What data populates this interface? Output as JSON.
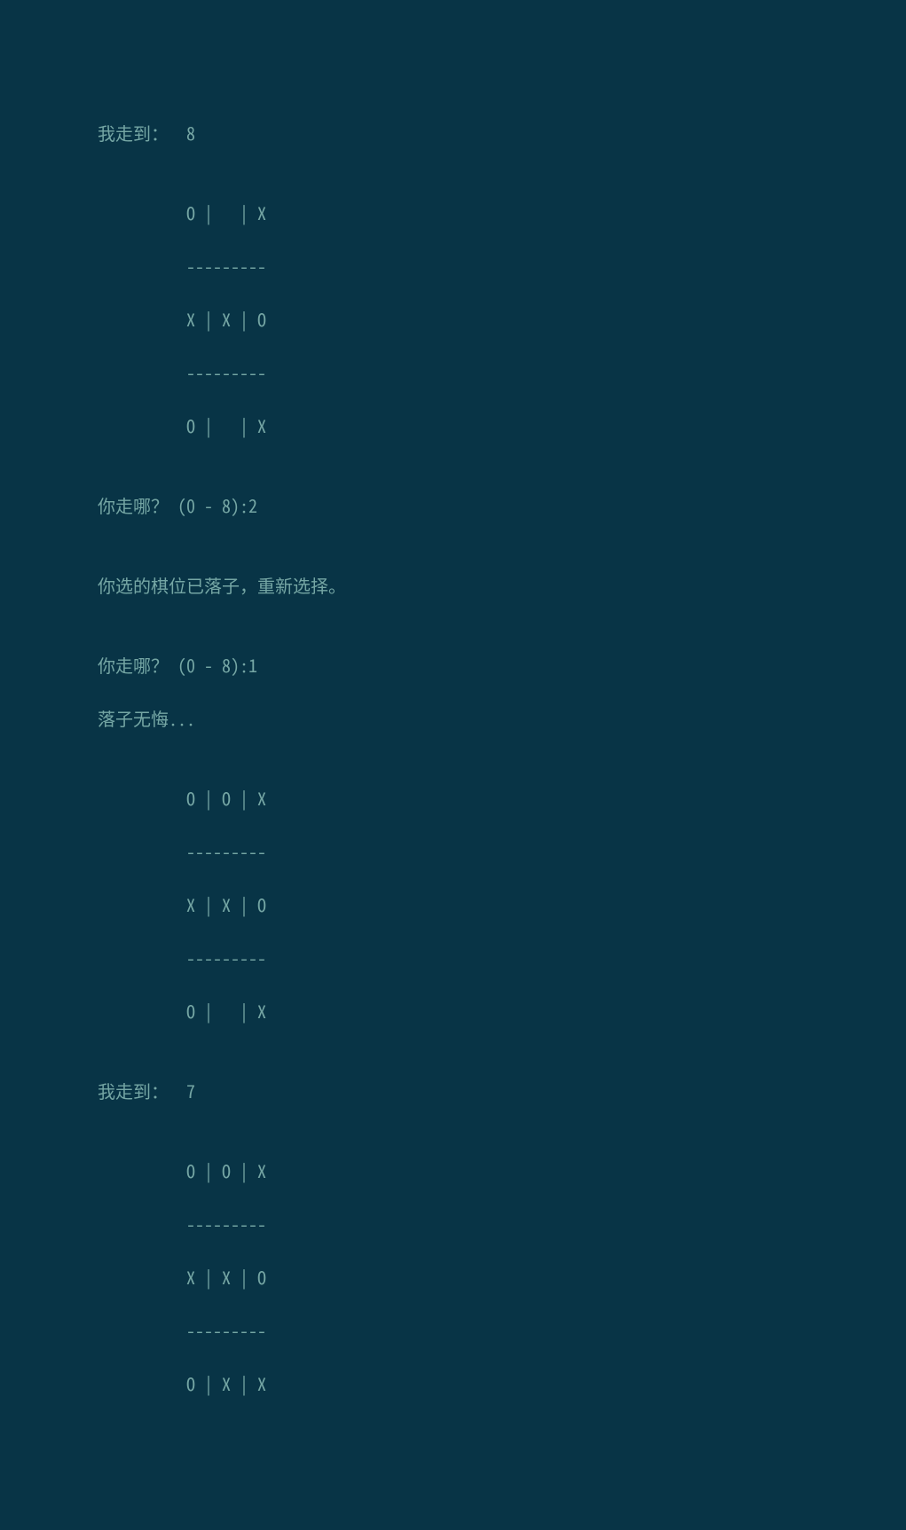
{
  "lines": [
    "我走到：  8",
    "",
    "          O |   | X",
    "          ---------",
    "          X | X | O",
    "          ---------",
    "          O |   | X",
    "",
    "你走哪？ (0 - 8):2",
    "",
    "你选的棋位已落子，重新选择。",
    "",
    "你走哪？ (0 - 8):1",
    "落子无悔...",
    "",
    "          O | O | X",
    "          ---------",
    "          X | X | O",
    "          ---------",
    "          O |   | X",
    "",
    "我走到：  7",
    "",
    "          O | O | X",
    "          ---------",
    "          X | X | O",
    "          ---------",
    "          O | X | X"
  ],
  "game": {
    "type": "tic-tac-toe",
    "boards": [
      {
        "move_by": "computer",
        "move_to": 8,
        "cells": [
          "O",
          "",
          "X",
          "X",
          "X",
          "O",
          "O",
          "",
          "X"
        ]
      },
      {
        "move_by": "player",
        "move_to": 1,
        "cells": [
          "O",
          "O",
          "X",
          "X",
          "X",
          "O",
          "O",
          "",
          "X"
        ]
      },
      {
        "move_by": "computer",
        "move_to": 7,
        "cells": [
          "O",
          "O",
          "X",
          "X",
          "X",
          "O",
          "O",
          "X",
          "X"
        ]
      }
    ],
    "prompts": [
      {
        "text": "你走哪？ (0 - 8):",
        "input": "2",
        "response": "你选的棋位已落子，重新选择。"
      },
      {
        "text": "你走哪？ (0 - 8):",
        "input": "1",
        "response": "落子无悔..."
      }
    ]
  }
}
